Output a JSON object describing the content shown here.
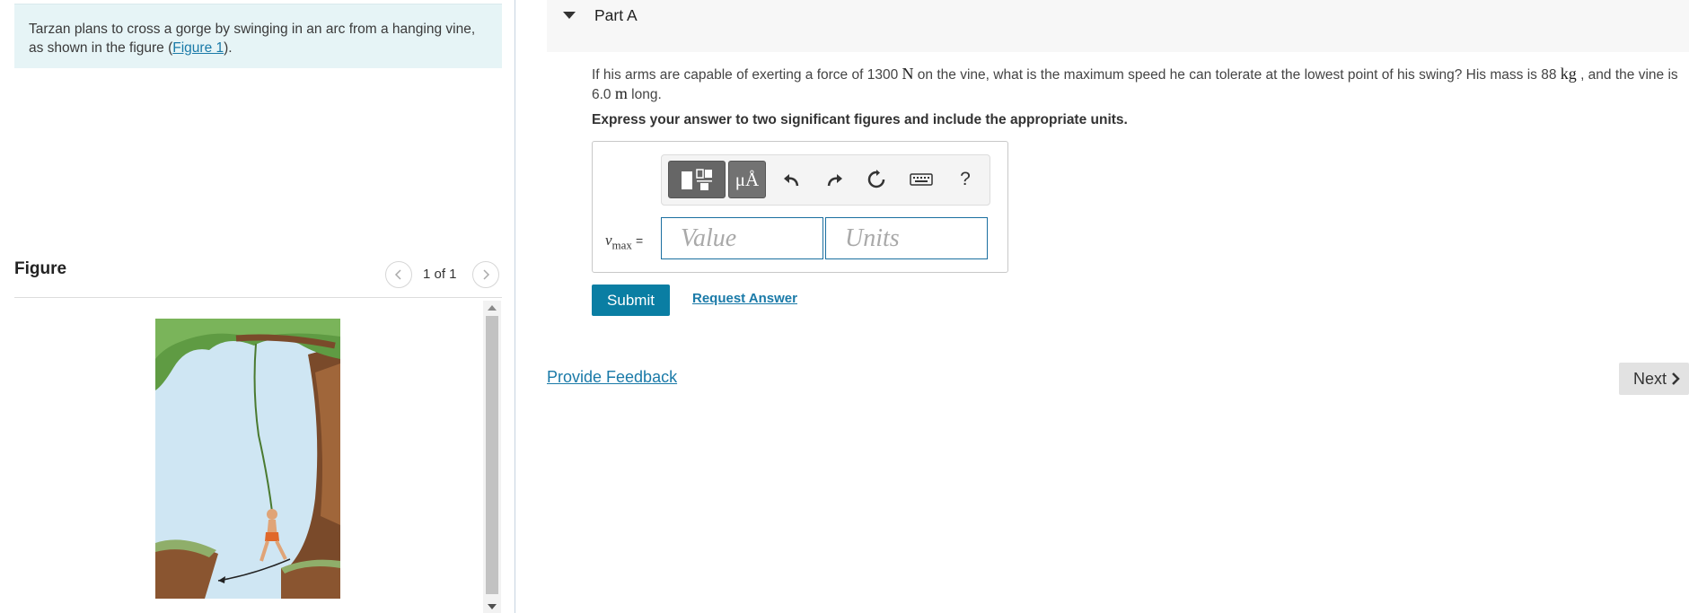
{
  "intro": {
    "text_before": "Tarzan plans to cross a gorge by swinging in an arc from a hanging vine, as shown in the figure (",
    "link": "Figure 1",
    "text_after": ")."
  },
  "figure_panel": {
    "title": "Figure",
    "count": "1 of 1"
  },
  "part": {
    "title": "Part A",
    "question": {
      "q1": "If his arms are capable of exerting a force of 1300 ",
      "u1": "N",
      "q2": " on the vine, what is the maximum speed he can tolerate at the lowest point of his swing? His mass is 88 ",
      "u2": "kg",
      "q3": " , and the vine is 6.0 ",
      "u3": "m",
      "q4": " long."
    },
    "instruction": "Express your answer to two significant figures and include the appropriate units."
  },
  "answer": {
    "var_symbol": "v",
    "var_sub": "max",
    "equals": "=",
    "value_placeholder": "Value",
    "units_placeholder": "Units",
    "toolbar": {
      "templates_icon": "templates-icon",
      "units_label": "μÅ",
      "undo_icon": "undo-icon",
      "redo_icon": "redo-icon",
      "reset_icon": "reset-icon",
      "keyboard_icon": "keyboard-icon",
      "help_label": "?"
    }
  },
  "actions": {
    "submit": "Submit",
    "request_answer": "Request Answer",
    "provide_feedback": "Provide Feedback",
    "next": "Next"
  },
  "colors": {
    "accent": "#0a7ea3",
    "link": "#1a7aa8",
    "intro_bg": "#e6f4f6"
  }
}
